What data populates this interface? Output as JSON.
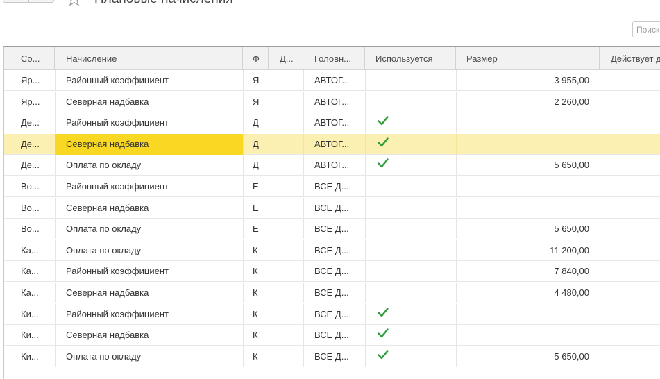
{
  "header": {
    "title": "Плановые начисления",
    "search_placeholder": "Поиск"
  },
  "table": {
    "columns": [
      "Со...",
      "Начисление",
      "Ф",
      "Д...",
      "Головн...",
      "Используется",
      "Размер",
      "Действует д"
    ],
    "rows": [
      {
        "employee": "Яр...",
        "accrual": "Районный коэффициент",
        "f": "Я",
        "d": "",
        "org": "АВТОГ...",
        "used": false,
        "amount": "3 955,00"
      },
      {
        "employee": "Яр...",
        "accrual": "Северная надбавка",
        "f": "Я",
        "d": "",
        "org": "АВТОГ...",
        "used": false,
        "amount": "2 260,00"
      },
      {
        "employee": "Де...",
        "accrual": "Районный коэффициент",
        "f": "Д",
        "d": "",
        "org": "АВТОГ...",
        "used": true,
        "amount": ""
      },
      {
        "employee": "Де...",
        "accrual": "Северная надбавка",
        "f": "Д",
        "d": "",
        "org": "АВТОГ...",
        "used": true,
        "amount": "",
        "selected": true
      },
      {
        "employee": "Де...",
        "accrual": "Оплата по окладу",
        "f": "Д",
        "d": "",
        "org": "АВТОГ...",
        "used": true,
        "amount": "5 650,00"
      },
      {
        "employee": "Во...",
        "accrual": "Районный коэффициент",
        "f": "Е",
        "d": "",
        "org": "ВСЕ Д...",
        "used": false,
        "amount": ""
      },
      {
        "employee": "Во...",
        "accrual": "Северная надбавка",
        "f": "Е",
        "d": "",
        "org": "ВСЕ Д...",
        "used": false,
        "amount": ""
      },
      {
        "employee": "Во...",
        "accrual": "Оплата по окладу",
        "f": "Е",
        "d": "",
        "org": "ВСЕ Д...",
        "used": false,
        "amount": "5 650,00"
      },
      {
        "employee": "Ка...",
        "accrual": "Оплата по окладу",
        "f": "К",
        "d": "",
        "org": "ВСЕ Д...",
        "used": false,
        "amount": "11 200,00"
      },
      {
        "employee": "Ка...",
        "accrual": "Районный коэффициент",
        "f": "К",
        "d": "",
        "org": "ВСЕ Д...",
        "used": false,
        "amount": "7 840,00"
      },
      {
        "employee": "Ка...",
        "accrual": "Северная надбавка",
        "f": "К",
        "d": "",
        "org": "ВСЕ Д...",
        "used": false,
        "amount": "4 480,00"
      },
      {
        "employee": "Ки...",
        "accrual": "Районный коэффициент",
        "f": "К",
        "d": "",
        "org": "ВСЕ Д...",
        "used": true,
        "amount": ""
      },
      {
        "employee": "Ки...",
        "accrual": "Северная надбавка",
        "f": "К",
        "d": "",
        "org": "ВСЕ Д...",
        "used": true,
        "amount": ""
      },
      {
        "employee": "Ки...",
        "accrual": "Оплата по окладу",
        "f": "К",
        "d": "",
        "org": "ВСЕ Д...",
        "used": true,
        "amount": "5 650,00"
      }
    ]
  },
  "colors": {
    "selected_row": "#fbf0b1",
    "current_cell": "#f9d823",
    "check": "#2e9b3a"
  },
  "icons": {
    "favorite": "star-icon",
    "used_mark": "check-icon"
  }
}
